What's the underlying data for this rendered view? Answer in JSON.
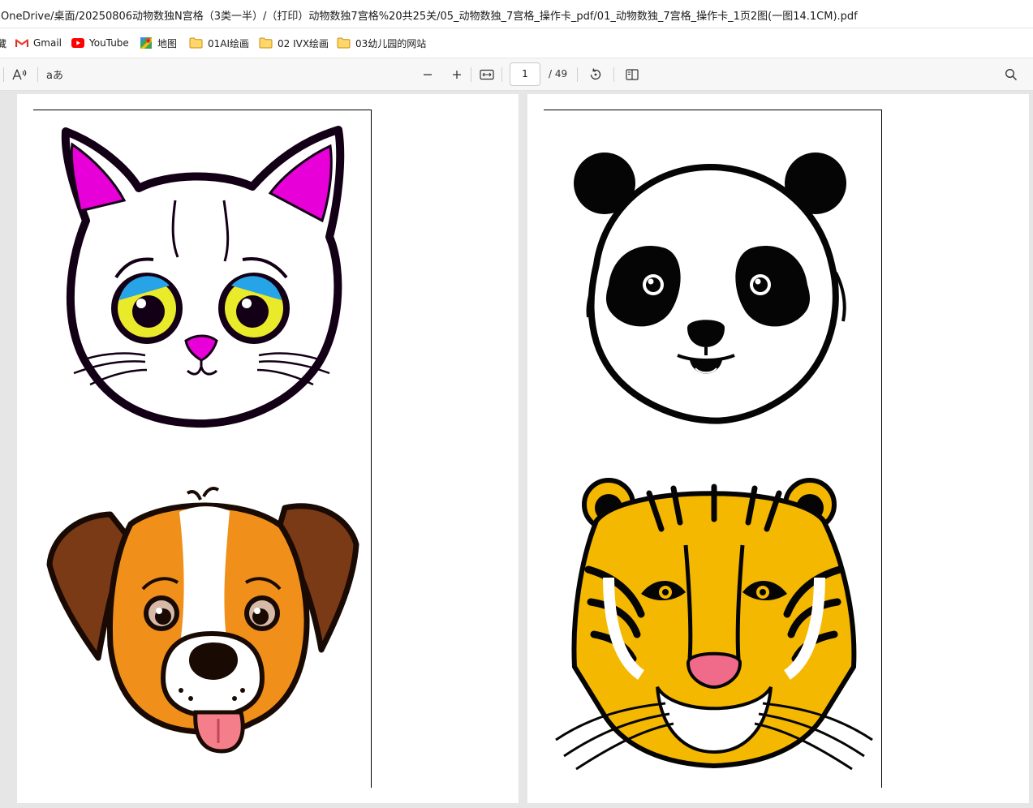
{
  "address_bar": {
    "url": "OneDrive/桌面/20250806动物数独N宫格（3类一半）/（打印）动物数独7宫格%20共25关/05_动物数独_7宫格_操作卡_pdf/01_动物数独_7宫格_操作卡_1页2图(一图14.1CM).pdf"
  },
  "bookmarks": [
    {
      "label": "藏",
      "icon": "bookmark-icon"
    },
    {
      "label": "Gmail",
      "icon": "gmail-icon"
    },
    {
      "label": "YouTube",
      "icon": "youtube-icon"
    },
    {
      "label": "地图",
      "icon": "maps-icon"
    },
    {
      "label": "01AI绘画",
      "icon": "folder-icon"
    },
    {
      "label": "02 IVX绘画",
      "icon": "folder-icon"
    },
    {
      "label": "03幼儿园的网站",
      "icon": "folder-icon"
    }
  ],
  "toolbar": {
    "current_page": "1",
    "total_pages": "/ 49",
    "tools": [
      "read-aloud-icon",
      "translate-icon",
      "zoom-out-icon",
      "zoom-in-icon",
      "fit-width-icon",
      "rotate-icon",
      "page-view-icon",
      "search-icon"
    ]
  },
  "pages": [
    {
      "animals": [
        "cat",
        "dog"
      ]
    },
    {
      "animals": [
        "panda",
        "tiger"
      ]
    }
  ],
  "colors": {
    "cat_ear": "#e800d8",
    "dog_orange": "#f0901a",
    "dog_brown": "#7a3a16",
    "tiger_yellow": "#f5b800",
    "tiger_nose": "#f06a8a",
    "toolbar_bg": "#f7f7f7",
    "viewer_bg": "#e6e6e6"
  }
}
